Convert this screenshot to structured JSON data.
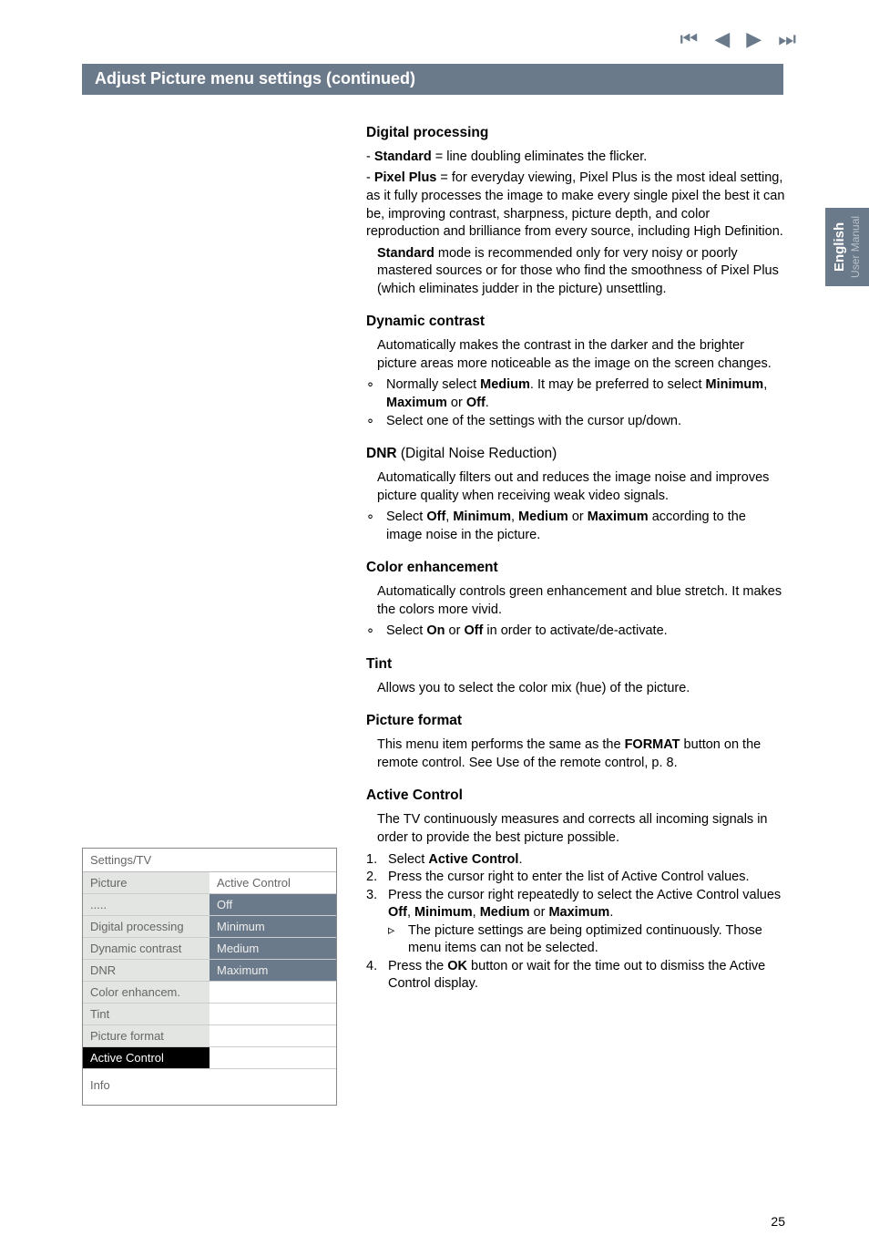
{
  "nav": {
    "first": "⏮",
    "prev": "◀",
    "play": "▶",
    "next": "⏭"
  },
  "banner": "Adjust Picture menu settings (continued)",
  "sideTab": {
    "lang": "English",
    "sub": "User Manual"
  },
  "section": {
    "digitalProcessing": {
      "title": "Digital processing",
      "li1a": "- ",
      "li1b": "Standard",
      "li1c": " = line doubling eliminates the flicker.",
      "li2a": "- ",
      "li2b": "Pixel Plus",
      "li2c": " = for everyday viewing, Pixel Plus is the most ideal setting, as it fully processes the image to make every single pixel the best it can be, improving contrast, sharpness, picture depth, and color reproduction and brilliance from every source, including High Definition.",
      "stdB": "Standard",
      "stdRest": " mode is recommended only for very noisy or poorly mastered sources or for those who find the smoothness of Pixel Plus (which eliminates judder in the picture) unsettling."
    },
    "dynamicContrast": {
      "title": "Dynamic contrast",
      "p": "Automatically makes the contrast in the darker and the brighter picture areas more noticeable as the image on the screen changes.",
      "b1a": "Normally select ",
      "b1b": "Medium",
      "b1c": ". It may be preferred to select ",
      "b1d": "Minimum",
      "b1e": ", ",
      "b1f": "Maximum",
      "b1g": " or ",
      "b1h": "Off",
      "b1i": ".",
      "b2": "Select one of the settings with the cursor up/down."
    },
    "dnr": {
      "titleB": "DNR",
      "titleRest": " (Digital Noise Reduction)",
      "p": "Automatically filters out and reduces the image noise and improves picture quality when receiving weak video signals.",
      "b1a": "Select ",
      "b1b": "Off",
      "b1c": ", ",
      "b1d": "Minimum",
      "b1e": ", ",
      "b1f": "Medium",
      "b1g": " or ",
      "b1h": "Maximum",
      "b1i": " according to the image noise in the picture."
    },
    "colorEnh": {
      "title": "Color enhancement",
      "p": "Automatically controls green enhancement and blue stretch. It makes the colors more vivid.",
      "b1a": "Select ",
      "b1b": "On",
      "b1c": " or ",
      "b1d": "Off",
      "b1e": " in order to activate/de-activate."
    },
    "tint": {
      "title": "Tint",
      "p": "Allows you to select the color mix (hue) of the picture."
    },
    "picFormat": {
      "title": "Picture format",
      "p1a": "This menu item performs the same as the ",
      "p1b": "FORMAT",
      "p1c": " button on the remote control. See Use of the remote control, p. 8."
    },
    "activeControl": {
      "title": "Active Control",
      "p": "The TV continuously measures and corrects all incoming signals in order to provide the best picture possible.",
      "n1a": "Select ",
      "n1b": "Active Control",
      "n1c": ".",
      "n2": "Press the cursor right to enter the list of Active Control values.",
      "n3a": "Press the cursor right repeatedly to select the Active Control values ",
      "n3b": "Off",
      "n3c": ", ",
      "n3d": "Minimum",
      "n3e": ", ",
      "n3f": "Medium",
      "n3g": " or ",
      "n3h": "Maximum",
      "n3i": ".",
      "n3sub": "The picture settings are being optimized continuously. Those menu items can not be selected.",
      "n4a": "Press the ",
      "n4b": "OK",
      "n4c": " button or wait for the time out to dismiss the Active Control display."
    }
  },
  "menu": {
    "hdr": "Settings/TV",
    "picture": "Picture",
    "activeControl": "Active Control",
    "dots": ".....",
    "off": "Off",
    "digproc": "Digital processing",
    "min": "Minimum",
    "dyncon": "Dynamic contrast",
    "med": "Medium",
    "dnr": "DNR",
    "max": "Maximum",
    "colen": "Color enhancem.",
    "tint": "Tint",
    "picfmt": "Picture format",
    "actctrl": "Active Control",
    "info": "Info"
  },
  "pageNum": "25"
}
